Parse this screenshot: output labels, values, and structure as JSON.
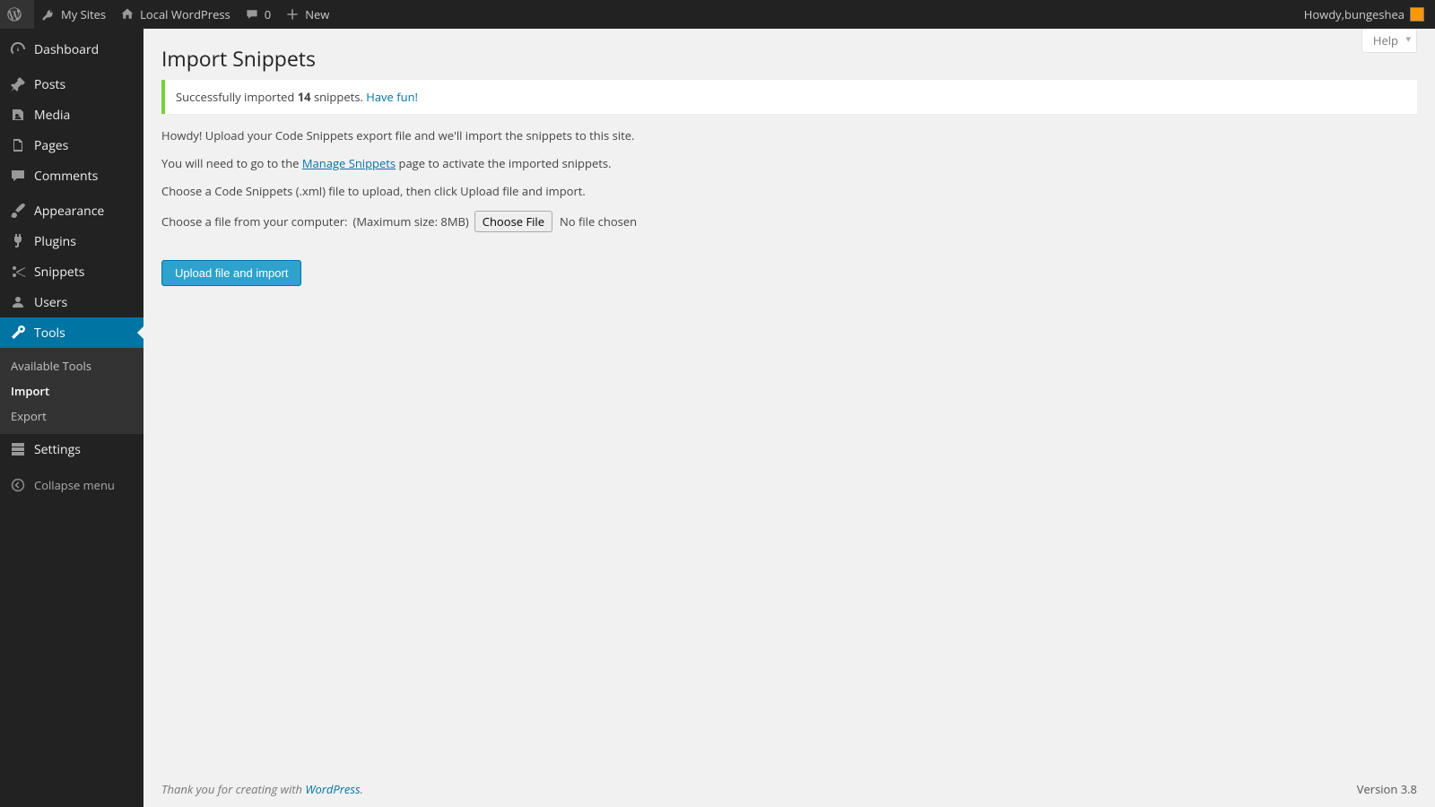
{
  "toolbar": {
    "my_sites": "My Sites",
    "site_name": "Local WordPress",
    "comments_count": "0",
    "new_label": "New",
    "howdy_prefix": "Howdy, ",
    "username": "bungeshea"
  },
  "sidebar": {
    "items": [
      {
        "label": "Dashboard",
        "icon": "dashboard"
      },
      {
        "label": "Posts",
        "icon": "pin"
      },
      {
        "label": "Media",
        "icon": "media"
      },
      {
        "label": "Pages",
        "icon": "page"
      },
      {
        "label": "Comments",
        "icon": "comment"
      },
      {
        "label": "Appearance",
        "icon": "brush"
      },
      {
        "label": "Plugins",
        "icon": "plug"
      },
      {
        "label": "Snippets",
        "icon": "scissors"
      },
      {
        "label": "Users",
        "icon": "user"
      },
      {
        "label": "Tools",
        "icon": "wrench"
      },
      {
        "label": "Settings",
        "icon": "settings"
      }
    ],
    "tools_submenu": [
      {
        "label": "Available Tools"
      },
      {
        "label": "Import"
      },
      {
        "label": "Export"
      }
    ],
    "collapse_label": "Collapse menu"
  },
  "screen": {
    "help_label": "Help",
    "title": "Import Snippets",
    "notice_prefix": "Successfully imported ",
    "notice_count": "14",
    "notice_mid": " snippets. ",
    "notice_link": "Have fun!",
    "desc1": "Howdy! Upload your Code Snippets export file and we'll import the snippets to this site.",
    "desc2a": "You will need to go to the ",
    "desc2_link": "Manage Snippets",
    "desc2b": " page to activate the imported snippets.",
    "desc3": "Choose a Code Snippets (.xml) file to upload, then click Upload file and import.",
    "file_label": "Choose a file from your computer:",
    "file_hint": "(Maximum size: 8MB)",
    "choose_btn": "Choose File",
    "file_status": "No file chosen",
    "submit_label": "Upload file and import"
  },
  "footer": {
    "thanks_prefix": "Thank you for creating with ",
    "thanks_link": "WordPress",
    "thanks_suffix": ".",
    "version": "Version 3.8"
  }
}
